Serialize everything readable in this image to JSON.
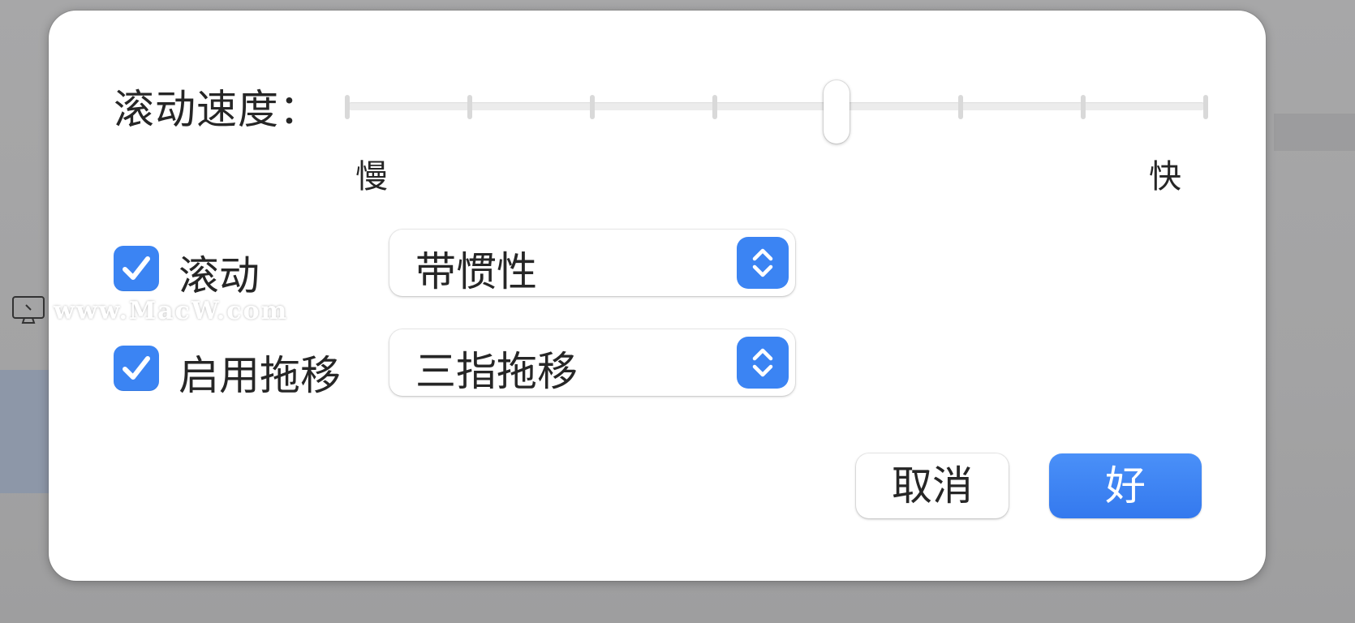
{
  "dialog": {
    "scroll_speed": {
      "label": "滚动速度：",
      "min_label": "慢",
      "max_label": "快",
      "tick_count": 8,
      "value_fraction": 0.57
    },
    "scroll_option": {
      "checked": true,
      "label": "滚动",
      "select_value": "带惯性"
    },
    "drag_option": {
      "checked": true,
      "label": "启用拖移",
      "select_value": "三指拖移"
    },
    "buttons": {
      "cancel_label": "取消",
      "ok_label": "好"
    }
  },
  "watermark": {
    "text": "www.MacW.com"
  },
  "colors": {
    "accent": "#3b84f3",
    "background": "#a5a5a6"
  }
}
